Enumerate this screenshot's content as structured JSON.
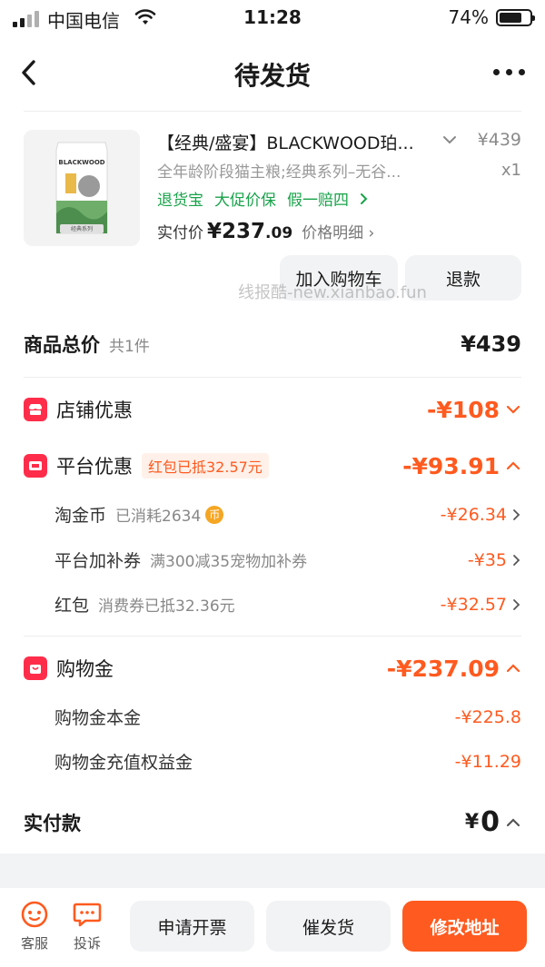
{
  "status_bar": {
    "carrier": "中国电信",
    "time": "11:28",
    "battery": "74%",
    "battery_level": 0.74,
    "signal_bars": 2
  },
  "nav": {
    "title": "待发货",
    "back_icon": "chevron-left-icon",
    "more_icon": "more-dots-icon"
  },
  "product": {
    "title": "【经典/盛宴】BLACKWOOD珀...",
    "price": "¥439",
    "sku": "全年龄阶段猫主粮;经典系列–无谷...",
    "qty": "x1",
    "services": [
      "退货宝",
      "大促价保",
      "假一赔四"
    ],
    "paid_label": "实付价",
    "paid_currency": "¥",
    "paid_int": "237",
    "paid_dec": ".09",
    "price_detail": "价格明细",
    "thumb_brand": "BLACKWOOD",
    "thumb_caption": "经典系列",
    "add_cart": "加入购物车",
    "refund": "退款"
  },
  "watermark": "线报酷-new.xianbao.fun",
  "summary": {
    "total_label": "商品总价",
    "total_count": "共1件",
    "total_amount": "¥439",
    "shop_discount_label": "店铺优惠",
    "shop_discount_amount": "-¥108",
    "platform_label": "平台优惠",
    "platform_tag": "红包已抵32.57元",
    "platform_amount": "-¥93.91",
    "platform_items": [
      {
        "label": "淘金币",
        "sub": "已消耗2634",
        "amount": "-¥26.34"
      },
      {
        "label": "平台加补券",
        "sub": "满300减35宠物加补券",
        "amount": "-¥35"
      },
      {
        "label": "红包",
        "sub": "消费券已抵32.36元",
        "amount": "-¥32.57"
      }
    ],
    "shopping_gold_label": "购物金",
    "shopping_gold_amount": "-¥237.09",
    "shopping_gold_items": [
      {
        "label": "购物金本金",
        "amount": "-¥225.8"
      },
      {
        "label": "购物金充值权益金",
        "amount": "-¥11.29"
      }
    ],
    "actual_label": "实付款",
    "actual_currency": "¥",
    "actual_amount": "0"
  },
  "bottom_bar": {
    "service": "客服",
    "complaint": "投诉",
    "invoice": "申请开票",
    "urge": "催发货",
    "change_address": "修改地址"
  },
  "colors": {
    "accent": "#ff5a1f",
    "green": "#18a34a",
    "badge_red": "#ff2d4a",
    "grey_btn": "#f2f3f5"
  }
}
